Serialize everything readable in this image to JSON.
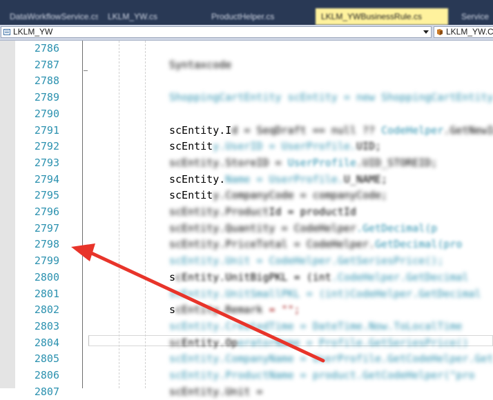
{
  "tabs": [
    {
      "label": "DataWorkflowService.cs"
    },
    {
      "label": "LKLM_YW.cs"
    },
    {
      "label": "ProductHelper.cs"
    },
    {
      "label": "LKLM_YWBusinessRule.cs"
    },
    {
      "label": "Service"
    }
  ],
  "navbar": {
    "project": "LKLM_YW",
    "member": "LKLM_YW.C"
  },
  "line_numbers": [
    "2786",
    "2787",
    "2788",
    "2789",
    "2790",
    "2791",
    "2792",
    "2793",
    "2794",
    "2795",
    "2796",
    "2797",
    "2798",
    "2799",
    "2800",
    "2801",
    "2802",
    "2803",
    "2804",
    "2805",
    "2806",
    "2807"
  ],
  "code": [
    {
      "b1": "",
      "v1": "",
      "b2": "",
      "v2": "",
      "b3": ""
    },
    {
      "b1": "",
      "v1": "",
      "b2": "Syntaxcode",
      "v2": "",
      "b3": ""
    },
    {
      "b1": "",
      "v1": "",
      "b2": "",
      "v2": "",
      "b3": ""
    },
    {
      "b1": "",
      "v1": "",
      "b2": "ShoppingCartEntity scEntity = new ShoppingCartEntity",
      "v2": "",
      "b3": ""
    },
    {
      "b1": "",
      "v1": "",
      "b2": "",
      "v2": "",
      "b3": ""
    },
    {
      "b1": "",
      "v1": "scEntity.I",
      "b2": "d = SeqDraft == null ?? ",
      "v2": "CodeHelper",
      "b3": ".GetNewId"
    },
    {
      "b1": "",
      "v1": "scEntit",
      "b2": "y.UserID = UserProfile.",
      "v2": "UID;",
      "b3": ""
    },
    {
      "b1": "",
      "v1": "",
      "b2": "scEntity.StoreID = ",
      "v2": "UserProfile",
      "b3": ".UID_STOREID;"
    },
    {
      "b1": "",
      "v1": "scEntity.",
      "b2": "Name = UserProfile.",
      "v2": "U_NAME;",
      "b3": ""
    },
    {
      "b1": "",
      "v1": "scEntit",
      "b2": "y.CompanyCode = companyCode;",
      "v2": "",
      "b3": ""
    },
    {
      "b1": "",
      "v1": "",
      "b2": "scEntity.Product",
      "v2": "Id = productId",
      "b3": ""
    },
    {
      "b1": "",
      "v1": "",
      "b2": "scEntity.Quantity = CodeHelper",
      "v2": ".GetDecimal(p",
      "b3": ""
    },
    {
      "b1": "",
      "v1": "",
      "b2": "scEntity.PriceTotal = CodeHelper.",
      "v2": "GetDecimal(pro",
      "b3": ""
    },
    {
      "b1": "",
      "v1": "",
      "b2": "scEntity.Unit = CodeHelper.GetSeriesPrice();",
      "v2": "",
      "b3": ""
    },
    {
      "b1": "",
      "v1": "s",
      "b2": "c",
      "v2": "Entity.UnitBigPKL = (int",
      "b3": ".CodeHelper.GetDecimal"
    },
    {
      "b1": "",
      "v1": "",
      "b2": "scEntity.UnitSmallPKL = (int)CodeHelper.GetDecimal",
      "v2": "",
      "b3": ""
    },
    {
      "b1": "",
      "v1": "s",
      "b2": "cEntity.Remark",
      "v2": " = \"\";",
      "b3": ""
    },
    {
      "b1": "",
      "v1": "",
      "b2": "scEntity.CreatedTime = DateTime.Now.ToLocalTime",
      "v2": "",
      "b3": ""
    },
    {
      "b1": "",
      "v1": "",
      "b2": "sc",
      "v2": "Entity.Op",
      "b3": "eratorName = Profile.GetSeriesPrice()"
    },
    {
      "b1": "",
      "v1": "",
      "b2": "scEntity.CompanyName = UserProfile.GetCodeHelper.Get",
      "v2": "",
      "b3": ""
    },
    {
      "b1": "",
      "v1": "",
      "b2": "scEntity.ProductName = product.GetCodeHelper(\"pro",
      "v2": "",
      "b3": ""
    },
    {
      "b1": "",
      "v1": "",
      "b2": "scEntity.Unit = ",
      "v2": "",
      "b3": ""
    }
  ],
  "colors": {
    "tabstrip_bg": "#293955",
    "active_tab": "#fff29d",
    "line_number": "#2b91af",
    "arrow": "#e8342a"
  },
  "icons": {
    "project": "project-file-icon",
    "member": "class-member-icon",
    "annotation": "red-arrow-annotation"
  }
}
